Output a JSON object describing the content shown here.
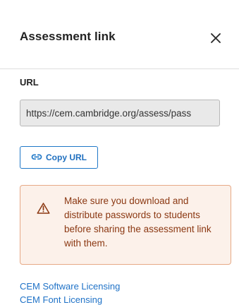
{
  "dialog": {
    "title": "Assessment link",
    "close_icon": "close-icon"
  },
  "url_section": {
    "label": "URL",
    "value": "https://cem.cambridge.org/assess/pass"
  },
  "copy": {
    "label": "Copy URL",
    "icon": "link-icon",
    "color": "#1f78c8"
  },
  "warning": {
    "icon": "warning-icon",
    "text": "Make sure you download and distribute passwords to students before sharing the assessment link with them.",
    "background": "#fcf1ea",
    "border": "#e6a986",
    "text_color": "#8b3812"
  },
  "footer": {
    "links": [
      "CEM Software Licensing",
      "CEM Font Licensing"
    ],
    "color": "#1f72c7"
  }
}
